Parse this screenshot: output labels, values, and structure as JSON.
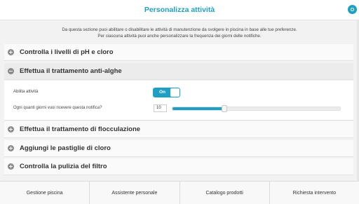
{
  "header": {
    "title": "Personalizza attività",
    "settings_icon": "settings-icon"
  },
  "intro": {
    "line1": "Da questa sezione puoi abilitare o disabilitare le attività di manutenzione da svolgere in piscina in base alle tue preferenze.",
    "line2": "Per ciascuna attività puoi anche personalizzare la frequenza dei giorni delle notifiche."
  },
  "tasks": [
    {
      "label": "Controlla i livelli di pH e cloro",
      "expanded": false
    },
    {
      "label": "Effettua il trattamento anti-alghe",
      "expanded": true
    },
    {
      "label": "Effettua il trattamento di flocculazione",
      "expanded": false
    },
    {
      "label": "Aggiungi le pastiglie di cloro",
      "expanded": false
    },
    {
      "label": "Controlla la pulizia del filtro",
      "expanded": false
    }
  ],
  "panel": {
    "enable_label": "Abilita attività",
    "toggle_text": "On",
    "frequency_label": "Ogni quanti giorni vuoi ricevere questa notifica?",
    "frequency_value": "10",
    "slider_fraction": 0.31
  },
  "tabs": [
    {
      "label": "Gestione piscina"
    },
    {
      "label": "Assistente personale"
    },
    {
      "label": "Catalogo prodotti"
    },
    {
      "label": "Richiesta intervento"
    }
  ],
  "colors": {
    "accent": "#1e9fc4",
    "icon_gray": "#8a8a8a"
  }
}
